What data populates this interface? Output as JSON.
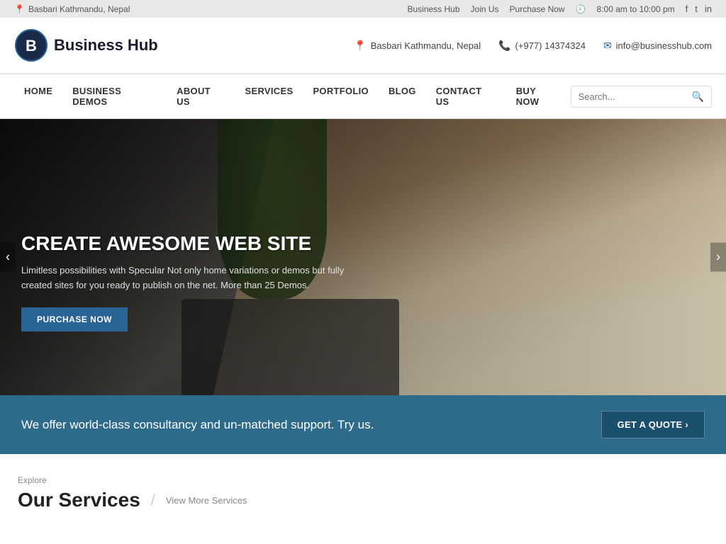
{
  "topbar": {
    "location": "Basbari Kathmandu, Nepal",
    "links": [
      "Business Hub",
      "Join Us",
      "Purchase Now"
    ],
    "hours": "8:00 am to 10:00 pm",
    "social": [
      "f",
      "t",
      "in"
    ]
  },
  "header": {
    "logo_text": "Business Hub",
    "contact": {
      "location": "Basbari Kathmandu, Nepal",
      "phone": "(+977) 14374324",
      "email": "info@businesshub.com"
    }
  },
  "nav": {
    "items": [
      {
        "label": "HOME",
        "href": "#"
      },
      {
        "label": "BUSINESS DEMOS",
        "href": "#"
      },
      {
        "label": "ABOUT US",
        "href": "#"
      },
      {
        "label": "SERVICES",
        "href": "#"
      },
      {
        "label": "PORTFOLIO",
        "href": "#"
      },
      {
        "label": "BLOG",
        "href": "#"
      },
      {
        "label": "CONTACT US",
        "href": "#"
      },
      {
        "label": "BUY NOW",
        "href": "#"
      }
    ],
    "search_placeholder": "Search..."
  },
  "hero": {
    "title": "CREATE AWESOME WEB SITE",
    "description": "Limitless possibilities with Specular Not only home variations or demos but fully created sites for you ready to publish on the net. More than 25 Demos.",
    "cta_label": "PURCHASE NOW"
  },
  "quote_banner": {
    "text": "We offer world-class consultancy and un-matched support. Try us.",
    "button_label": "GET A QUOTE ›"
  },
  "services": {
    "label": "Explore",
    "heading": "Our Services",
    "link_label": "View More Services",
    "divider": "/"
  }
}
